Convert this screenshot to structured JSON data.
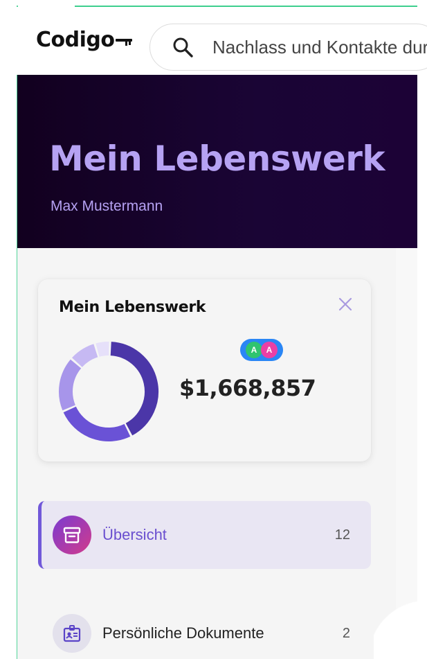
{
  "app": {
    "logo_text": "Codigo"
  },
  "search": {
    "placeholder": "Nachlass und Kontakte durchsuchen"
  },
  "hero": {
    "title": "Mein Lebenswerk",
    "subtitle": "Max Mustermann"
  },
  "card": {
    "title": "Mein Lebenswerk",
    "total": "$1,668,857",
    "avatars": [
      "A",
      "A"
    ],
    "chart_data": {
      "type": "pie",
      "series": [
        {
          "values": [
            0.42,
            0.26,
            0.18,
            0.09,
            0.05
          ]
        }
      ]
    }
  },
  "nav": [
    {
      "label": "Übersicht",
      "count": "12",
      "icon": "archive-box-icon"
    },
    {
      "label": "Persönliche Dokumente",
      "count": "2",
      "icon": "id-badge-icon"
    }
  ],
  "colors": {
    "accent": "#7158d9",
    "hero_bg": "#12001f",
    "hero_text": "#b6a2f3",
    "donut": [
      "#4b36a8",
      "#6a52d6",
      "#a795ea",
      "#c6b9f3",
      "#e6e0fa"
    ]
  }
}
